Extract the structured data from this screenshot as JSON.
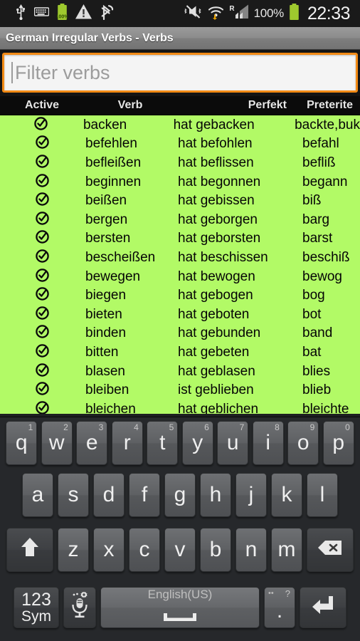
{
  "statusbar": {
    "icons_left": [
      "usb-icon",
      "keyboard-icon",
      "battery-charging-icon",
      "warning-icon",
      "bluetooth-tethering-icon"
    ],
    "battery_badge": "100%",
    "icons_right": [
      "vibrate-mute-icon",
      "wifi-transfer-icon",
      "roaming-signal-icon"
    ],
    "roaming_label": "R",
    "battery_percent": "100%",
    "clock": "22:33"
  },
  "titlebar": {
    "title": "German Irregular Verbs - Verbs"
  },
  "filter": {
    "value": "",
    "placeholder": "Filter verbs",
    "accent_color": "#f28a15"
  },
  "table": {
    "columns": [
      "Active",
      "Verb",
      "Perfekt",
      "Preterite"
    ],
    "row_background": "#b2fa66",
    "rows": [
      {
        "active": "check-circle-icon",
        "verb": "backen",
        "perfekt": "hat gebacken",
        "preterite": "backte,buk"
      },
      {
        "active": "check-circle-icon",
        "verb": "befehlen",
        "perfekt": "hat befohlen",
        "preterite": "befahl"
      },
      {
        "active": "check-circle-icon",
        "verb": "befleißen",
        "perfekt": "hat beflissen",
        "preterite": "befliß"
      },
      {
        "active": "check-circle-icon",
        "verb": "beginnen",
        "perfekt": "hat begonnen",
        "preterite": "begann"
      },
      {
        "active": "check-circle-icon",
        "verb": "beißen",
        "perfekt": "hat gebissen",
        "preterite": "biß"
      },
      {
        "active": "check-circle-icon",
        "verb": "bergen",
        "perfekt": "hat geborgen",
        "preterite": "barg"
      },
      {
        "active": "check-circle-icon",
        "verb": "bersten",
        "perfekt": "hat geborsten",
        "preterite": "barst"
      },
      {
        "active": "check-circle-icon",
        "verb": "bescheißen",
        "perfekt": "hat beschissen",
        "preterite": "beschiß"
      },
      {
        "active": "check-circle-icon",
        "verb": "bewegen",
        "perfekt": "hat bewogen",
        "preterite": "bewog"
      },
      {
        "active": "check-circle-icon",
        "verb": "biegen",
        "perfekt": "hat gebogen",
        "preterite": "bog"
      },
      {
        "active": "check-circle-icon",
        "verb": "bieten",
        "perfekt": "hat geboten",
        "preterite": "bot"
      },
      {
        "active": "check-circle-icon",
        "verb": "binden",
        "perfekt": "hat gebunden",
        "preterite": "band"
      },
      {
        "active": "check-circle-icon",
        "verb": "bitten",
        "perfekt": "hat gebeten",
        "preterite": "bat"
      },
      {
        "active": "check-circle-icon",
        "verb": "blasen",
        "perfekt": "hat geblasen",
        "preterite": "blies"
      },
      {
        "active": "check-circle-icon",
        "verb": "bleiben",
        "perfekt": "ist geblieben",
        "preterite": "blieb"
      },
      {
        "active": "check-circle-icon",
        "verb": "bleichen",
        "perfekt": "hat geblichen",
        "preterite": "bleichte"
      }
    ]
  },
  "keyboard": {
    "row1": [
      {
        "label": "q",
        "num": "1"
      },
      {
        "label": "w",
        "num": "2"
      },
      {
        "label": "e",
        "num": "3"
      },
      {
        "label": "r",
        "num": "4"
      },
      {
        "label": "t",
        "num": "5"
      },
      {
        "label": "y",
        "num": "6"
      },
      {
        "label": "u",
        "num": "7"
      },
      {
        "label": "i",
        "num": "8"
      },
      {
        "label": "o",
        "num": "9"
      },
      {
        "label": "p",
        "num": "0"
      }
    ],
    "row2": [
      {
        "label": "a"
      },
      {
        "label": "s"
      },
      {
        "label": "d"
      },
      {
        "label": "f"
      },
      {
        "label": "g"
      },
      {
        "label": "h"
      },
      {
        "label": "j"
      },
      {
        "label": "k"
      },
      {
        "label": "l"
      }
    ],
    "row3": {
      "shift": "shift-arrow-icon",
      "letters": [
        {
          "label": "z"
        },
        {
          "label": "x"
        },
        {
          "label": "c"
        },
        {
          "label": "v"
        },
        {
          "label": "b"
        },
        {
          "label": "n"
        },
        {
          "label": "m"
        }
      ],
      "backspace": "backspace-icon"
    },
    "row4": {
      "sym_line1": "123",
      "sym_line2": "Sym",
      "mic": "microphone-settings-icon",
      "space_label": "English(US)",
      "space_glyph": "spacebar-icon",
      "period_label": ".",
      "period_alt": "?",
      "enter": "enter-arrow-icon"
    }
  }
}
